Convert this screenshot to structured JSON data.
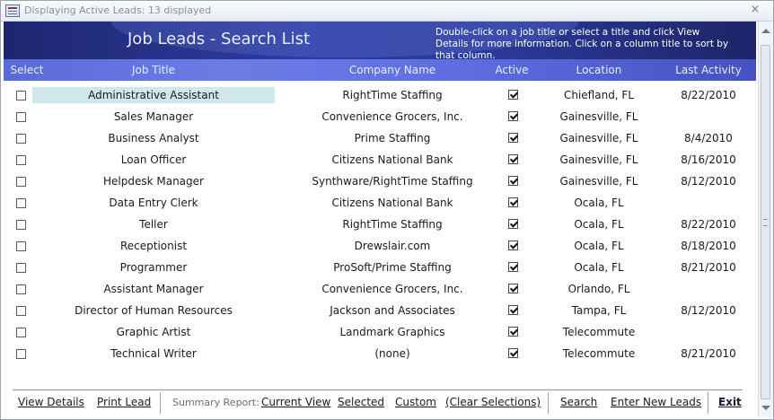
{
  "window": {
    "title": "Displaying Active Leads:  13 displayed",
    "close_glyph": "×"
  },
  "header": {
    "title": "Job Leads - Search List",
    "help": "Double-click on a job title or select a title and click View Details for more information.  Click on a column title to sort by that column."
  },
  "columns": {
    "select": "Select",
    "job_title": "Job Title",
    "company": "Company Name",
    "active": "Active",
    "location": "Location",
    "last_activity": "Last Activity"
  },
  "rows": [
    {
      "job_title": "Administrative Assistant",
      "company": "RightTime Staffing",
      "active": true,
      "location": "Chiefland, FL",
      "last_activity": "8/22/2010",
      "selected": false,
      "highlighted": true
    },
    {
      "job_title": "Sales Manager",
      "company": "Convenience Grocers, Inc.",
      "active": true,
      "location": "Gainesville, FL",
      "last_activity": "",
      "selected": false
    },
    {
      "job_title": "Business Analyst",
      "company": "Prime Staffing",
      "active": true,
      "location": "Gainesville, FL",
      "last_activity": "8/4/2010",
      "selected": false
    },
    {
      "job_title": "Loan Officer",
      "company": "Citizens National Bank",
      "active": true,
      "location": "Gainesville, FL",
      "last_activity": "8/16/2010",
      "selected": false
    },
    {
      "job_title": "Helpdesk Manager",
      "company": "Synthware/RightTime Staffing",
      "active": true,
      "location": "Gainesville, FL",
      "last_activity": "8/12/2010",
      "selected": false
    },
    {
      "job_title": "Data Entry Clerk",
      "company": "Citizens National Bank",
      "active": true,
      "location": "Ocala, FL",
      "last_activity": "",
      "selected": false
    },
    {
      "job_title": "Teller",
      "company": "RightTime Staffing",
      "active": true,
      "location": "Ocala, FL",
      "last_activity": "8/22/2010",
      "selected": false
    },
    {
      "job_title": "Receptionist",
      "company": "Drewslair.com",
      "active": true,
      "location": "Ocala, FL",
      "last_activity": "8/18/2010",
      "selected": false
    },
    {
      "job_title": "Programmer",
      "company": "ProSoft/Prime Staffing",
      "active": true,
      "location": "Ocala, FL",
      "last_activity": "8/21/2010",
      "selected": false
    },
    {
      "job_title": "Assistant Manager",
      "company": "Convenience Grocers, Inc.",
      "active": true,
      "location": "Orlando, FL",
      "last_activity": "",
      "selected": false
    },
    {
      "job_title": "Director of Human Resources",
      "company": "Jackson and Associates",
      "active": true,
      "location": "Tampa, FL",
      "last_activity": "8/12/2010",
      "selected": false
    },
    {
      "job_title": "Graphic Artist",
      "company": "Landmark Graphics",
      "active": true,
      "location": "Telecommute",
      "last_activity": "",
      "selected": false
    },
    {
      "job_title": "Technical Writer",
      "company": "(none)",
      "active": true,
      "location": "Telecommute",
      "last_activity": "8/21/2010",
      "selected": false
    }
  ],
  "footer": {
    "view_details": "View  Details",
    "print_lead": "Print Lead",
    "summary_label": "Summary Report:",
    "current_view": "Current View",
    "selected": "Selected",
    "custom": "Custom",
    "clear_selections": "(Clear Selections)",
    "search": "Search",
    "enter_new_leads": "Enter New Leads",
    "exit": "Exit"
  },
  "colors": {
    "header_bg": "#2e3ca0",
    "column_header_bg": "#6c7ce6",
    "highlight": "#cfe8ee"
  }
}
